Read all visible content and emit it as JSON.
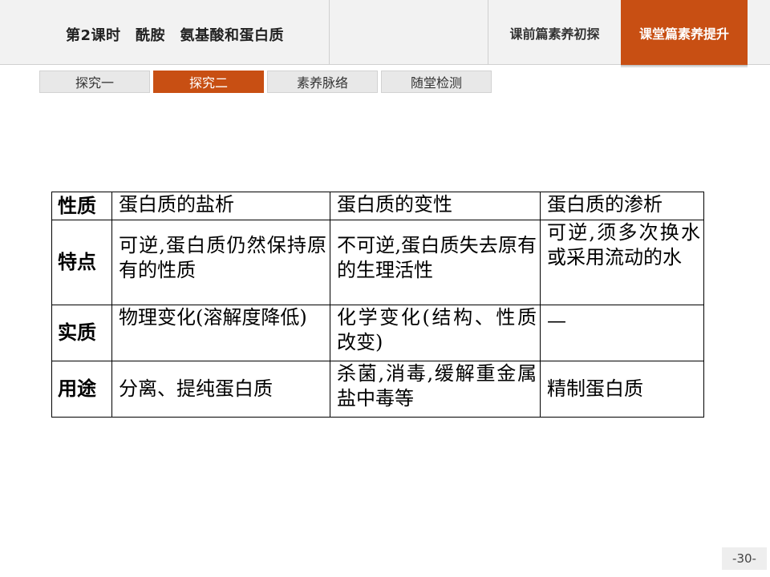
{
  "header": {
    "lesson_title": "第2课时　酰胺　氨基酸和蛋白质",
    "nav_tabs": [
      {
        "label": "课前篇素养初探",
        "active": false
      },
      {
        "label": "课堂篇素养提升",
        "active": true
      }
    ],
    "accent_color": "#c84f13"
  },
  "subtabs": [
    {
      "label": "探究一",
      "active": false
    },
    {
      "label": "探究二",
      "active": true
    },
    {
      "label": "素养脉络",
      "active": false
    },
    {
      "label": "随堂检测",
      "active": false
    }
  ],
  "table": {
    "header": [
      "性质",
      "蛋白质的盐析",
      "蛋白质的变性",
      "蛋白质的渗析"
    ],
    "rows": [
      {
        "label": "特点",
        "cells": [
          "可逆,蛋白质仍然保持原有的性质",
          "不可逆,蛋白质失去原有的生理活性",
          "可逆,须多次换水或采用流动的水"
        ]
      },
      {
        "label": "实质",
        "cells": [
          "物理变化(溶解度降低)",
          "化学变化(结构、性质改变)",
          "—"
        ]
      },
      {
        "label": "用途",
        "cells": [
          "分离、提纯蛋白质",
          "杀菌,消毒,缓解重金属盐中毒等",
          "精制蛋白质"
        ]
      }
    ]
  },
  "page_number": "-30-"
}
